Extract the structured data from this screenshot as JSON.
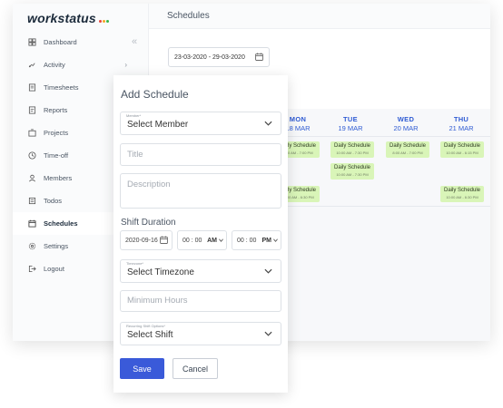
{
  "app": {
    "logo_text": "workstatus",
    "logo_dot_colors": [
      "#e8453c",
      "#f5a623",
      "#39b54a"
    ]
  },
  "header": {
    "title": "Schedules"
  },
  "sidebar": {
    "items": [
      {
        "label": "Dashboard",
        "icon": "dashboard-icon"
      },
      {
        "label": "Activity",
        "icon": "activity-icon",
        "has_chevron": true
      },
      {
        "label": "Timesheets",
        "icon": "timesheet-icon"
      },
      {
        "label": "Reports",
        "icon": "reports-icon"
      },
      {
        "label": "Projects",
        "icon": "projects-icon"
      },
      {
        "label": "Time-off",
        "icon": "clock-icon"
      },
      {
        "label": "Members",
        "icon": "user-icon"
      },
      {
        "label": "Todos",
        "icon": "todo-icon"
      },
      {
        "label": "Schedules",
        "icon": "calendar-icon",
        "active": true
      },
      {
        "label": "Settings",
        "icon": "gear-icon"
      },
      {
        "label": "Logout",
        "icon": "logout-icon"
      }
    ]
  },
  "toolbar": {
    "date_range": "23-03-2020 - 29-03-2020"
  },
  "calendar": {
    "days": [
      {
        "name": "MON",
        "date": "18 MAR"
      },
      {
        "name": "TUE",
        "date": "19 MAR"
      },
      {
        "name": "WED",
        "date": "20 MAR"
      },
      {
        "name": "THU",
        "date": "21 MAR"
      }
    ],
    "shift_title": "Daily Schedule",
    "shift_times": [
      "9:00 AM",
      "7:00 PM",
      "10:00 AM",
      "7:30 PM",
      "8:00 AM",
      "7:00 PM",
      "10:00 AM",
      "6:15 PM",
      "10:00 AM",
      "6:30 PM"
    ],
    "accent_color": "#2f5bd3",
    "shift_color": "#d9f5b8"
  },
  "modal": {
    "title": "Add Schedule",
    "member": {
      "label": "Member*",
      "value": "Select Member"
    },
    "title_field": {
      "placeholder": "Title"
    },
    "description_field": {
      "placeholder": "Description"
    },
    "shift_duration": {
      "label": "Shift Duration",
      "date": "2020-09-16",
      "start_time": "00 : 00",
      "start_ampm": "AM",
      "end_time": "00 : 00",
      "end_ampm": "PM"
    },
    "timezone": {
      "label": "Timezone*",
      "value": "Select Timezone"
    },
    "minimum_hours": {
      "placeholder": "Minimum Hours"
    },
    "recurring": {
      "label": "Recurring Shift Options*",
      "value": "Select Shift"
    },
    "save_label": "Save",
    "cancel_label": "Cancel",
    "primary_color": "#3a5ad9"
  }
}
